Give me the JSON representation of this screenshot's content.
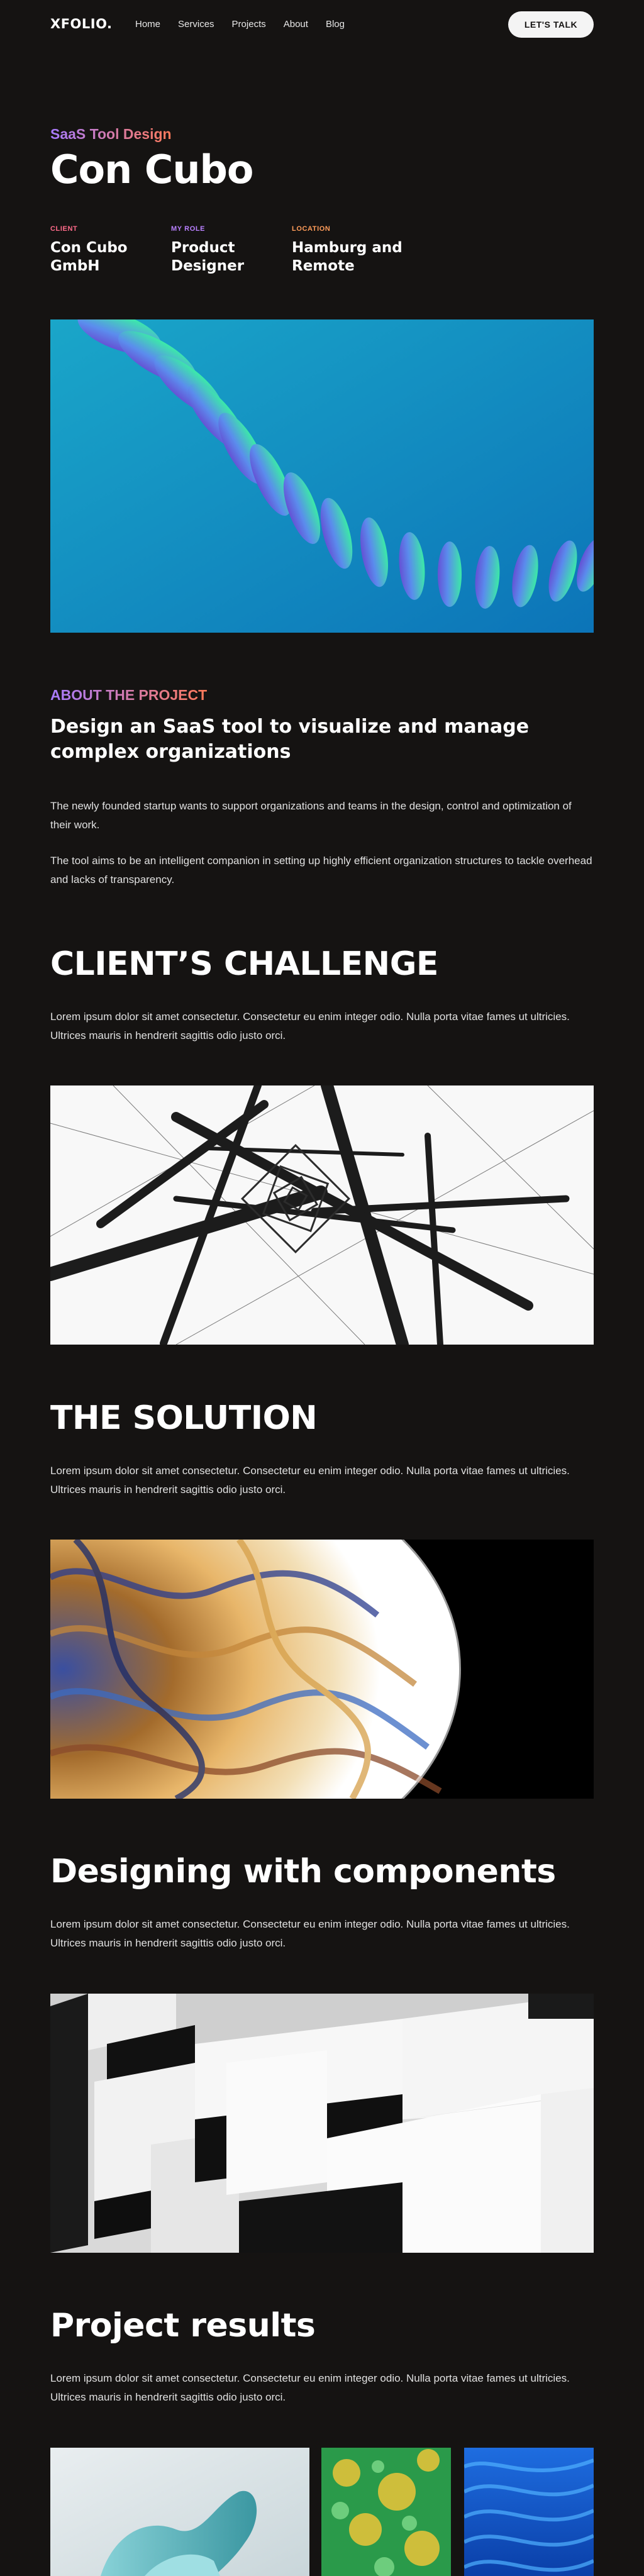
{
  "nav": {
    "logo": "XFOLIO.",
    "links": [
      "Home",
      "Services",
      "Projects",
      "About",
      "Blog"
    ],
    "cta": "LET'S TALK"
  },
  "hero": {
    "eyebrow": "SaaS Tool Design",
    "title": "Con Cubo",
    "meta": [
      {
        "label": "CLIENT",
        "value_line1": "Con Cubo",
        "value_line2": "GmbH"
      },
      {
        "label": "MY ROLE",
        "value_line1": "Product",
        "value_line2": "Designer"
      },
      {
        "label": "LOCATION",
        "value_line1": "Hamburg and",
        "value_line2": "Remote"
      }
    ]
  },
  "about": {
    "label": "ABOUT THE PROJECT",
    "heading": "Design an SaaS tool to visualize and manage complex organizations",
    "para1": "The newly founded startup wants to support organizations and teams in the design, control and optimization of their work.",
    "para2": "The tool aims to be an intelligent companion in setting up highly efficient organization structures to tackle overhead and lacks of transparency."
  },
  "sections": [
    {
      "heading": "CLIENT’S CHALLENGE",
      "text": "Lorem ipsum dolor sit amet consectetur. Consectetur eu enim integer odio. Nulla porta vitae fames ut ultricies. Ultrices mauris in hendrerit sagittis odio justo orci."
    },
    {
      "heading": "THE SOLUTION",
      "text": "Lorem ipsum dolor sit amet consectetur. Consectetur eu enim integer odio. Nulla porta vitae fames ut ultricies. Ultrices mauris in hendrerit sagittis odio justo orci."
    },
    {
      "heading": "Designing with components",
      "text": "Lorem ipsum dolor sit amet consectetur. Consectetur eu enim integer odio. Nulla porta vitae fames ut ultricies. Ultrices mauris in hendrerit sagittis odio justo orci."
    },
    {
      "heading": "Project results",
      "text": "Lorem ipsum dolor sit amet consectetur. Consectetur eu enim integer odio. Nulla porta vitae fames ut ultricies. Ultrices mauris in hendrerit sagittis odio justo orci."
    }
  ],
  "colors": {
    "background": "#151312",
    "accent_purple": "#a77bff",
    "accent_orange": "#ff7a59",
    "accent_pink": "#ff6b8a"
  }
}
